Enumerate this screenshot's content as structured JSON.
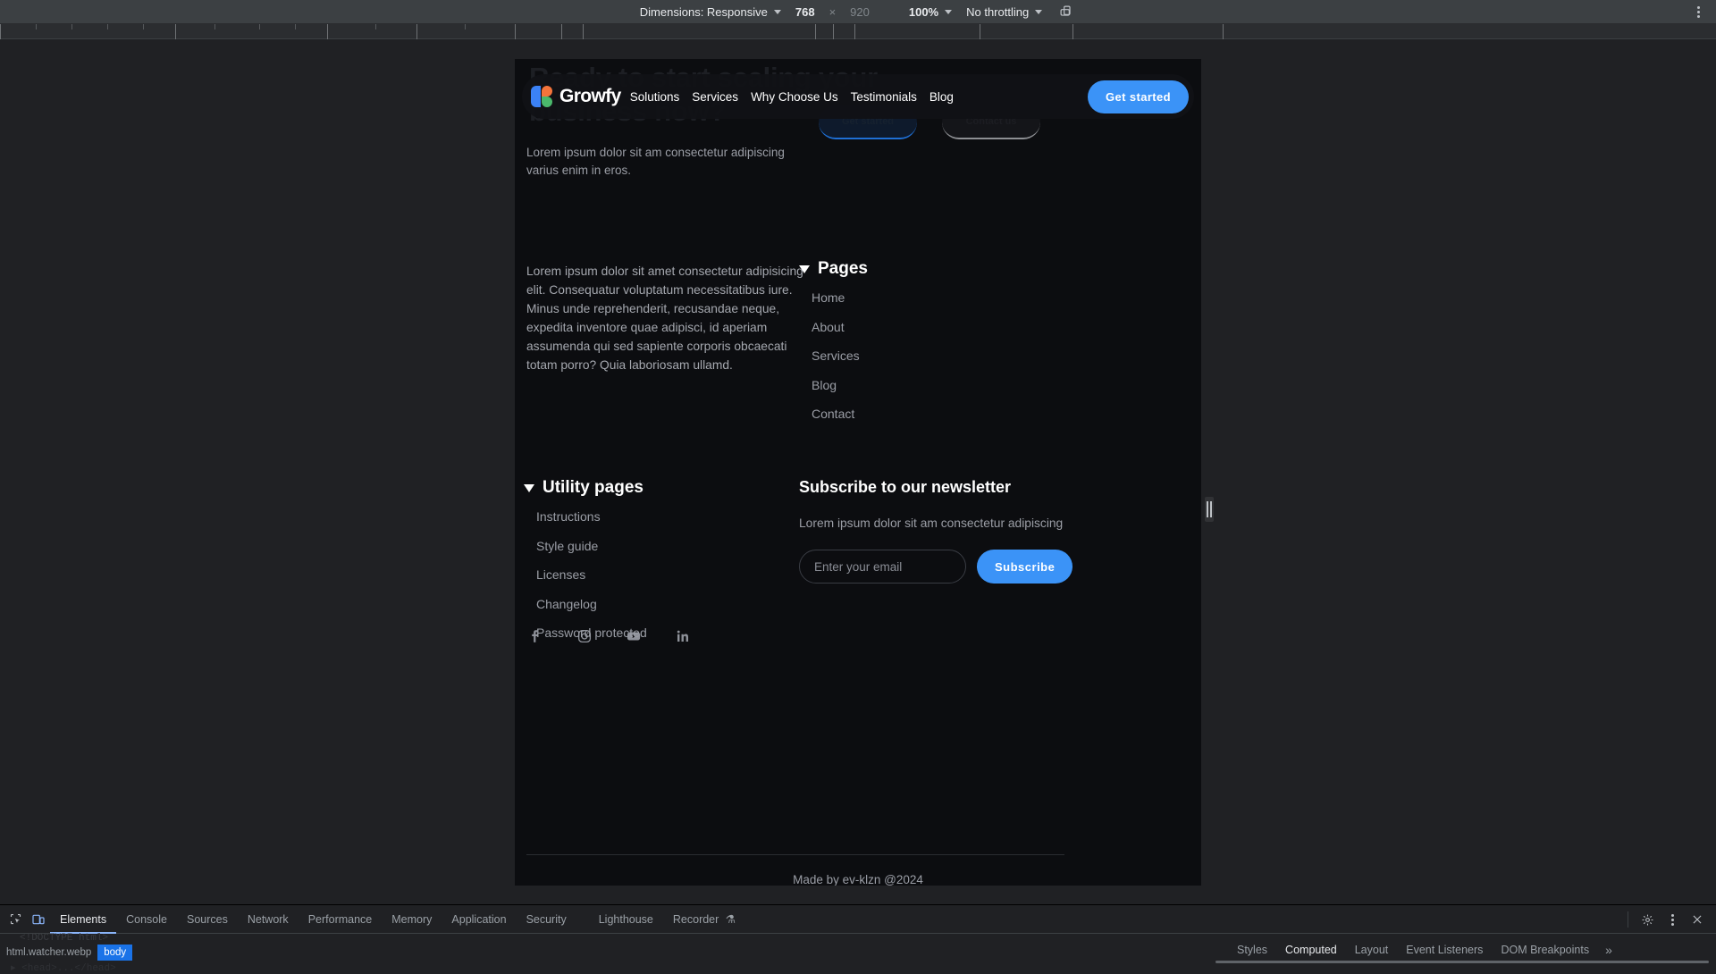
{
  "device_toolbar": {
    "dimensions_label": "Dimensions: Responsive",
    "width_value": "768",
    "x_symbol": "×",
    "height_placeholder": "920",
    "zoom_label": "100%",
    "throttling_label": "No throttling",
    "rotate_icon": "rotate-device-icon",
    "more_options_icon": "kebab-menu-icon"
  },
  "site": {
    "hero": {
      "ghost_heading": "Ready to start scaling your business now?",
      "ghost_btn_primary": "Get started",
      "ghost_btn_secondary": "Contact us",
      "subtext": "Lorem ipsum dolor sit am consectetur adipiscing varius enim in eros."
    },
    "nav": {
      "brand": "Growfy",
      "logo_icon": "growfy-logo-icon",
      "links": [
        {
          "label": "Solutions"
        },
        {
          "label": "Services"
        },
        {
          "label": "Why Choose Us"
        },
        {
          "label": "Testimonials"
        },
        {
          "label": "Blog"
        }
      ],
      "cta_label": "Get started",
      "accent_color": "#3b93f7"
    },
    "footer": {
      "about_text": "Lorem ipsum dolor sit amet consectetur adipisicing elit. Consequatur voluptatum necessitatibus iure. Minus unde reprehenderit, recusandae neque, expedita inventore quae adipisci, id aperiam assumenda qui sed sapiente corporis obcaecati totam porro? Quia laboriosam ullamd.",
      "socials": [
        {
          "name": "facebook-icon",
          "label": "Facebook"
        },
        {
          "name": "instagram-icon",
          "label": "Instagram"
        },
        {
          "name": "youtube-icon",
          "label": "YouTube"
        },
        {
          "name": "linkedin-icon",
          "label": "LinkedIn"
        }
      ],
      "pages": {
        "title": "Pages",
        "links": [
          {
            "label": "Home"
          },
          {
            "label": "About"
          },
          {
            "label": "Services"
          },
          {
            "label": "Blog"
          },
          {
            "label": "Contact"
          }
        ]
      },
      "utility": {
        "title": "Utility pages",
        "links": [
          {
            "label": "Instructions"
          },
          {
            "label": "Style guide"
          },
          {
            "label": "Licenses"
          },
          {
            "label": "Changelog"
          },
          {
            "label": "Password protected"
          }
        ]
      },
      "newsletter": {
        "title": "Subscribe to our newsletter",
        "description": "Lorem ipsum dolor sit am consectetur adipiscing",
        "input_placeholder": "Enter your email",
        "input_value": "",
        "button_label": "Subscribe"
      },
      "credit": "Made by ev-klzn @2024"
    }
  },
  "devtools": {
    "inspect_icon": "inspect-element-icon",
    "device_toggle_icon": "device-toolbar-icon",
    "tabs": [
      {
        "label": "Elements",
        "active": true
      },
      {
        "label": "Console",
        "active": false
      },
      {
        "label": "Sources",
        "active": false
      },
      {
        "label": "Network",
        "active": false
      },
      {
        "label": "Performance",
        "active": false
      },
      {
        "label": "Memory",
        "active": false
      },
      {
        "label": "Application",
        "active": false
      },
      {
        "label": "Security",
        "active": false
      },
      {
        "label": "Lighthouse",
        "active": false
      },
      {
        "label": "Recorder",
        "active": false
      }
    ],
    "recorder_badge_icon": "experiment-flask-icon",
    "settings_icon": "gear-icon",
    "more_icon": "kebab-menu-icon",
    "close_icon": "close-icon",
    "dom_snippet": "<!DOCTYPE html>",
    "dom_snippet2": "▸ <head>...</head>",
    "breadcrumbs": [
      {
        "label": "html.watcher.webp",
        "active": false
      },
      {
        "label": "body",
        "active": true
      }
    ],
    "sidebar_tabs": [
      {
        "label": "Styles",
        "active": false
      },
      {
        "label": "Computed",
        "active": true
      },
      {
        "label": "Layout",
        "active": false
      },
      {
        "label": "Event Listeners",
        "active": false
      },
      {
        "label": "DOM Breakpoints",
        "active": false
      }
    ],
    "sidebar_more": "»"
  }
}
